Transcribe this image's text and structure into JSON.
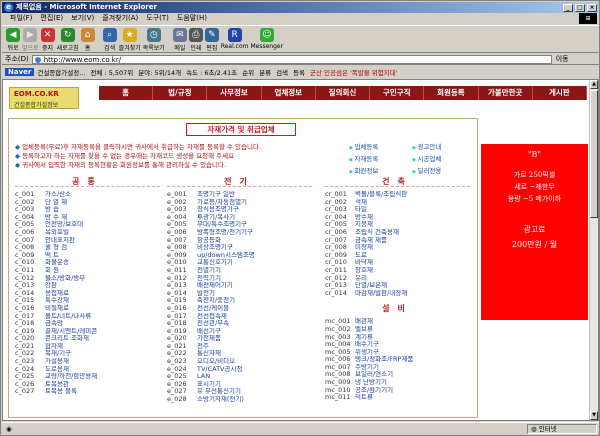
{
  "window": {
    "title": "제목없음 - Microsoft Internet Explorer"
  },
  "menu": [
    "파일(F)",
    "편집(E)",
    "보기(V)",
    "즐겨찾기(A)",
    "도구(T)",
    "도움말(H)"
  ],
  "toolbar": [
    {
      "label": "뒤로",
      "icon": "back-arrow-icon"
    },
    {
      "label": "앞으로",
      "icon": "forward-arrow-icon"
    },
    {
      "label": "중지",
      "icon": "stop-icon"
    },
    {
      "label": "새로고침",
      "icon": "refresh-icon"
    },
    {
      "label": "홈",
      "icon": "home-icon"
    },
    {
      "label": "검색",
      "icon": "search-icon"
    },
    {
      "label": "즐겨찾기",
      "icon": "favorites-icon"
    },
    {
      "label": "목록보기",
      "icon": "history-icon"
    },
    {
      "label": "메일",
      "icon": "mail-icon"
    },
    {
      "label": "인쇄",
      "icon": "print-icon"
    },
    {
      "label": "편집",
      "icon": "edit-icon"
    },
    {
      "label": "Real.com",
      "icon": "realcom-icon"
    },
    {
      "label": "Messenger",
      "icon": "messenger-icon"
    }
  ],
  "address": {
    "label": "주소(D)",
    "url": "http://www.eom.co.kr/",
    "go": "이동"
  },
  "linkbar": {
    "naver": "Naver",
    "items": [
      "건설종합가설정...",
      "전체 : 5,507위",
      "분야: 5위/14개",
      "속도 : 6초/2.41초",
      "순위",
      "분류",
      "검색",
      "등록"
    ],
    "news": "군산 인공섬은 '폭발물 위험지대'"
  },
  "site": {
    "logo_title": "EOM.CO.KR",
    "logo_sub": "건설종합가설정보",
    "nav": [
      "홈",
      "법/규정",
      "사무정보",
      "업체정보",
      "질의회신",
      "구인구직",
      "회원등록",
      "가볼만한곳",
      "게시판"
    ],
    "section_title": "자재가격 및 취급업체",
    "notices": [
      "업체등록(무료)후 자재등록을 클릭하시면 귀사에서 취급하는 자재를 등록할 수 있습니다.",
      "등록하고자 하는 자재를 찾을 수 없는 경우에는 자재코드 생성을 요청해 주세요",
      "귀사에서 입력한 자재의 등록현황은 회원정보를 통해 관리하실 수 있습니다."
    ],
    "quick_links": [
      "업체등록",
      "광고안내",
      "자재등록",
      "시공업체",
      "회원정보",
      "딜러전용"
    ],
    "columns": [
      {
        "title": "공통",
        "items": [
          [
            "c_001",
            "가스/산소"
          ],
          [
            "c_002",
            "단 열 재"
          ],
          [
            "c_003",
            "방 습"
          ],
          [
            "c_004",
            "방 수 재"
          ],
          [
            "c_005",
            "안전망/보호대"
          ],
          [
            "c_006",
            "옥외포빌"
          ],
          [
            "c_007",
            "안내표지판"
          ],
          [
            "c_008",
            "월 형 검"
          ],
          [
            "c_009",
            "떡 트"
          ],
          [
            "c_010",
            "화물운송"
          ],
          [
            "c_011",
            "회 원"
          ],
          [
            "c_012",
            "불소/방화/방부"
          ],
          [
            "c_013",
            "강판"
          ],
          [
            "c_014",
            "용접재료"
          ],
          [
            "c_015",
            "특수강재"
          ],
          [
            "c_016",
            "비철재료"
          ],
          [
            "c_017",
            "볼트/너트/나사류"
          ],
          [
            "c_018",
            "금속망"
          ],
          [
            "c_019",
            "골재/시멘트/레미콘"
          ],
          [
            "c_020",
            "콘크리트 조화재"
          ],
          [
            "c_021",
            "합자재"
          ],
          [
            "c_022",
            "목재/기구"
          ],
          [
            "c_023",
            "가설용재"
          ],
          [
            "c_024",
            "도로용재"
          ],
          [
            "c_025",
            "교량/하천/항만용재"
          ],
          [
            "c_026",
            "토목용관"
          ],
          [
            "c_027",
            "토목용 블록"
          ]
        ]
      },
      {
        "title": "전기",
        "items": [
          [
            "e_001",
            "조명기구 일반"
          ],
          [
            "e_002",
            "가로등/자동점멸기"
          ],
          [
            "e_003",
            "장식용조명기구"
          ],
          [
            "e_004",
            "투광기/복사기"
          ],
          [
            "e_005",
            "무대/특수조명기구"
          ],
          [
            "e_006",
            "방폭형조명/전기기구"
          ],
          [
            "e_007",
            "항공등화"
          ],
          [
            "e_008",
            "비상조명기구"
          ],
          [
            "e_009",
            "up/down시스템조명"
          ],
          [
            "e_010",
            "교통신호기기"
          ],
          [
            "e_011",
            "전열기기"
          ],
          [
            "e_012",
            "전력기기"
          ],
          [
            "e_013",
            "배전제어기기"
          ],
          [
            "e_014",
            "발전기"
          ],
          [
            "e_015",
            "축전지/충전기"
          ],
          [
            "e_016",
            "전선/케이블"
          ],
          [
            "e_017",
            "전선접속재"
          ],
          [
            "e_018",
            "전선관/부속"
          ],
          [
            "e_019",
            "배선기구"
          ],
          [
            "e_020",
            "가전제품"
          ],
          [
            "e_021",
            "전주"
          ],
          [
            "e_022",
            "통신자재"
          ],
          [
            "e_023",
            "오디오/비디오"
          ],
          [
            "e_024",
            "TV/CATV공시청"
          ],
          [
            "e_025",
            "LAN"
          ],
          [
            "e_026",
            "표시기기"
          ],
          [
            "e_027",
            "유 무선통신기기"
          ],
          [
            "e_028",
            "소방기자재(전기)"
          ]
        ]
      },
      {
        "title": "건축",
        "items": [
          [
            "cr_001",
            "벽돌/블록/조립식판"
          ],
          [
            "cr_002",
            "석재"
          ],
          [
            "cr_003",
            "타일"
          ],
          [
            "cr_004",
            "방수재"
          ],
          [
            "cr_005",
            "지붕재"
          ],
          [
            "cr_006",
            "조립식 건축용재"
          ],
          [
            "cr_007",
            "금속재 제품"
          ],
          [
            "cr_008",
            "미장재"
          ],
          [
            "cr_009",
            "도료"
          ],
          [
            "cr_010",
            "바닥재"
          ],
          [
            "cr_011",
            "창호재"
          ],
          [
            "cr_012",
            "유리"
          ],
          [
            "cr_013",
            "단열/보온재"
          ],
          [
            "cr_014",
            "마감재/발판/내장재"
          ]
        ]
      },
      {
        "title": "설비",
        "items": [
          [
            "mc_001",
            "배관재"
          ],
          [
            "mc_002",
            "밸브류"
          ],
          [
            "mc_003",
            "계기류"
          ],
          [
            "mc_004",
            "배수기구"
          ],
          [
            "mc_005",
            "위생기구"
          ],
          [
            "mc_006",
            "탱크/정화조/FRP제품"
          ],
          [
            "mc_007",
            "주방기기"
          ],
          [
            "mc_008",
            "보일러/연소기"
          ],
          [
            "mc_009",
            "냉 난방기기"
          ],
          [
            "mc_010",
            "공조/환기기기"
          ],
          [
            "mc_011",
            "덕트류"
          ]
        ]
      }
    ],
    "ad": {
      "mark": "\"B\"",
      "line1": "가로 250픽셀",
      "line2": "세로 ~제한무",
      "line3": "용량 ~5 메가이하",
      "line4": "광고료",
      "line5": "200만원 / 월"
    }
  },
  "status": {
    "zone": "인터넷"
  }
}
